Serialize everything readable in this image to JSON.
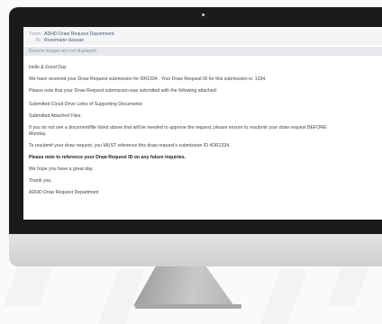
{
  "email": {
    "from_label": "From:",
    "from_value": "ADHD Draw Request Department",
    "to_label": "To:",
    "to_value": "Rosemarie Hassan",
    "remote_images_notice": "Remote images are not displayed.",
    "body": {
      "greeting": "Hello & Good Day.",
      "received": "We have received your Draw Request submission for DR1334 . Your Draw Request ID for this submission is: 1334.",
      "note_attached": "Please note that your Draw Request submission was submitted with the following attached:",
      "cloud_links": "Submitted Cloud Drive Links of Supporting Documents:",
      "attached_files": "Submitted Attached Files:",
      "missing_doc_1": "If you do not see a document/file listed above that will be needed to approve the request, please ensure to resubmit your draw request BEFORE",
      "missing_doc_2": "Monday.",
      "resubmit": "To resubmit your draw request, you MUST reference this draw request's submission ID #DR1334.",
      "reference_note": "Please note to reference your Draw Request ID on any future inquiries.",
      "wish": "We hope you have a great day.",
      "thanks": "Thank you,",
      "signature": "ADHD Draw Request Department"
    }
  }
}
